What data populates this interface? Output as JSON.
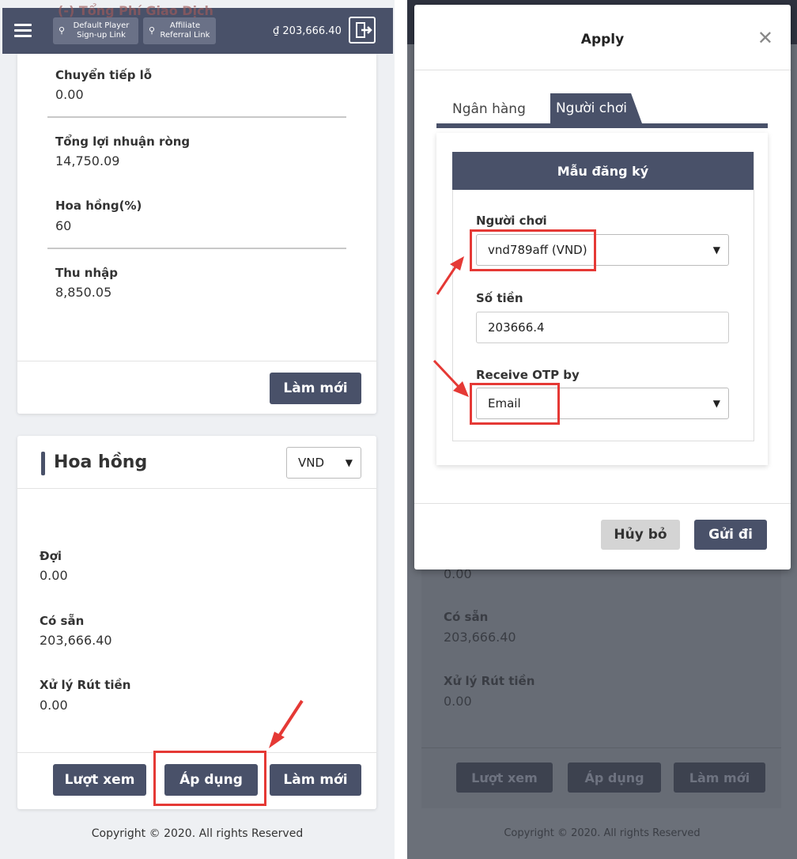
{
  "left": {
    "topbar": {
      "ghost_text": "(-) Tổng Phí Giao Dịch",
      "menu_icon": "hamburger-icon",
      "default_player_link": "Default Player Sign-up Link",
      "affiliate_link": "Affiliate Referral Link",
      "link_icon": "link-icon",
      "balance": "₫ 203,666.40",
      "logout_icon": "logout-icon"
    },
    "summary": {
      "fields": [
        {
          "label": "Chuyển tiếp lỗ",
          "value": "0.00"
        },
        {
          "label": "Tổng lợi nhuận ròng",
          "value": "14,750.09"
        },
        {
          "label": "Hoa hồng(%)",
          "value": "60"
        },
        {
          "label": "Thu nhập",
          "value": "8,850.05"
        }
      ],
      "refresh_label": "Làm mới"
    },
    "commission": {
      "title": "Hoa hồng",
      "currency": "VND",
      "fields": [
        {
          "label": "Đợi",
          "value": "0.00"
        },
        {
          "label": "Có sẵn",
          "value": "203,666.40"
        },
        {
          "label": "Xử lý Rút tiền",
          "value": "0.00"
        }
      ],
      "view_label": "Lượt xem",
      "apply_label": "Áp dụng",
      "refresh_label": "Làm mới"
    },
    "footer": "Copyright © 2020. All rights Reserved"
  },
  "right": {
    "background": {
      "partial_value": "0.00",
      "fields": [
        {
          "label": "Có sẵn",
          "value": "203,666.40"
        },
        {
          "label": "Xử lý Rút tiền",
          "value": "0.00"
        }
      ],
      "view_label": "Lượt xem",
      "apply_label": "Áp dụng",
      "refresh_label": "Làm mới",
      "footer": "Copyright © 2020. All rights Reserved"
    },
    "modal": {
      "title": "Apply",
      "close_icon": "close-icon",
      "tabs": [
        "Ngân hàng",
        "Người chơi"
      ],
      "form_title": "Mẫu đăng ký",
      "player_label": "Người chơi",
      "player_value": "vnd789aff (VND)",
      "amount_label": "Số tiền",
      "amount_value": "203666.4",
      "otp_label": "Receive OTP by",
      "otp_value": "Email",
      "cancel_label": "Hủy bỏ",
      "submit_label": "Gửi đi"
    }
  },
  "colors": {
    "primary": "#495169",
    "highlight": "#e53935",
    "overlay": "#6b7079"
  }
}
